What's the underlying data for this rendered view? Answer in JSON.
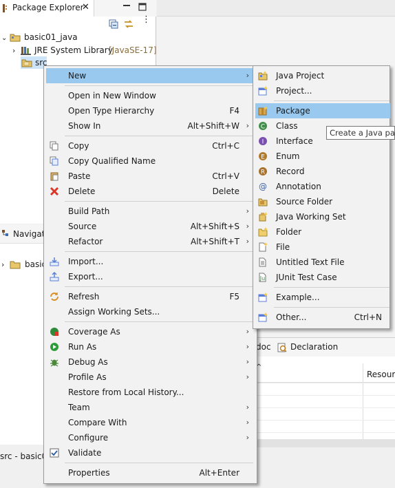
{
  "package_explorer": {
    "tab_title": "Package Explorer",
    "project_name": "basic01_java",
    "library_name": "JRE System Library",
    "library_detail": "[JavaSE-17]",
    "src_folder": "src"
  },
  "navigator": {
    "tab_title": "Navigato",
    "project_name": "basic"
  },
  "status_bar": {
    "text": "src - basic01"
  },
  "bottom_views": {
    "tab_javadoc_partial": "doc",
    "tab_declaration": "Declaration",
    "column_resource_partial": "Resourc"
  },
  "context_menu": {
    "new": "New",
    "open_in_new_window": "Open in New Window",
    "open_type_hierarchy": "Open Type Hierarchy",
    "open_type_hierarchy_accel": "F4",
    "show_in": "Show In",
    "show_in_accel": "Alt+Shift+W",
    "copy": "Copy",
    "copy_accel": "Ctrl+C",
    "copy_qualified_name": "Copy Qualified Name",
    "paste": "Paste",
    "paste_accel": "Ctrl+V",
    "delete": "Delete",
    "delete_accel": "Delete",
    "build_path": "Build Path",
    "source": "Source",
    "source_accel": "Alt+Shift+S",
    "refactor": "Refactor",
    "refactor_accel": "Alt+Shift+T",
    "import": "Import...",
    "export": "Export...",
    "refresh": "Refresh",
    "refresh_accel": "F5",
    "assign_working_sets": "Assign Working Sets...",
    "coverage_as": "Coverage As",
    "run_as": "Run As",
    "debug_as": "Debug As",
    "profile_as": "Profile As",
    "restore_history": "Restore from Local History...",
    "team": "Team",
    "compare_with": "Compare With",
    "configure": "Configure",
    "validate": "Validate",
    "properties": "Properties",
    "properties_accel": "Alt+Enter"
  },
  "sub_menu": {
    "java_project": "Java Project",
    "project": "Project...",
    "package": "Package",
    "class": "Class",
    "interface": "Interface",
    "enum": "Enum",
    "record": "Record",
    "annotation": "Annotation",
    "source_folder": "Source Folder",
    "java_working_set": "Java Working Set",
    "folder": "Folder",
    "file": "File",
    "untitled_text_file": "Untitled Text File",
    "junit_test_case": "JUnit Test Case",
    "example": "Example...",
    "other": "Other...",
    "other_accel": "Ctrl+N"
  },
  "tooltip": {
    "text": "Create a Java pack"
  },
  "colors": {
    "selection": "#99c9ef",
    "menu_bg": "#f2f2f2",
    "library_detail": "#8a6d3b"
  }
}
